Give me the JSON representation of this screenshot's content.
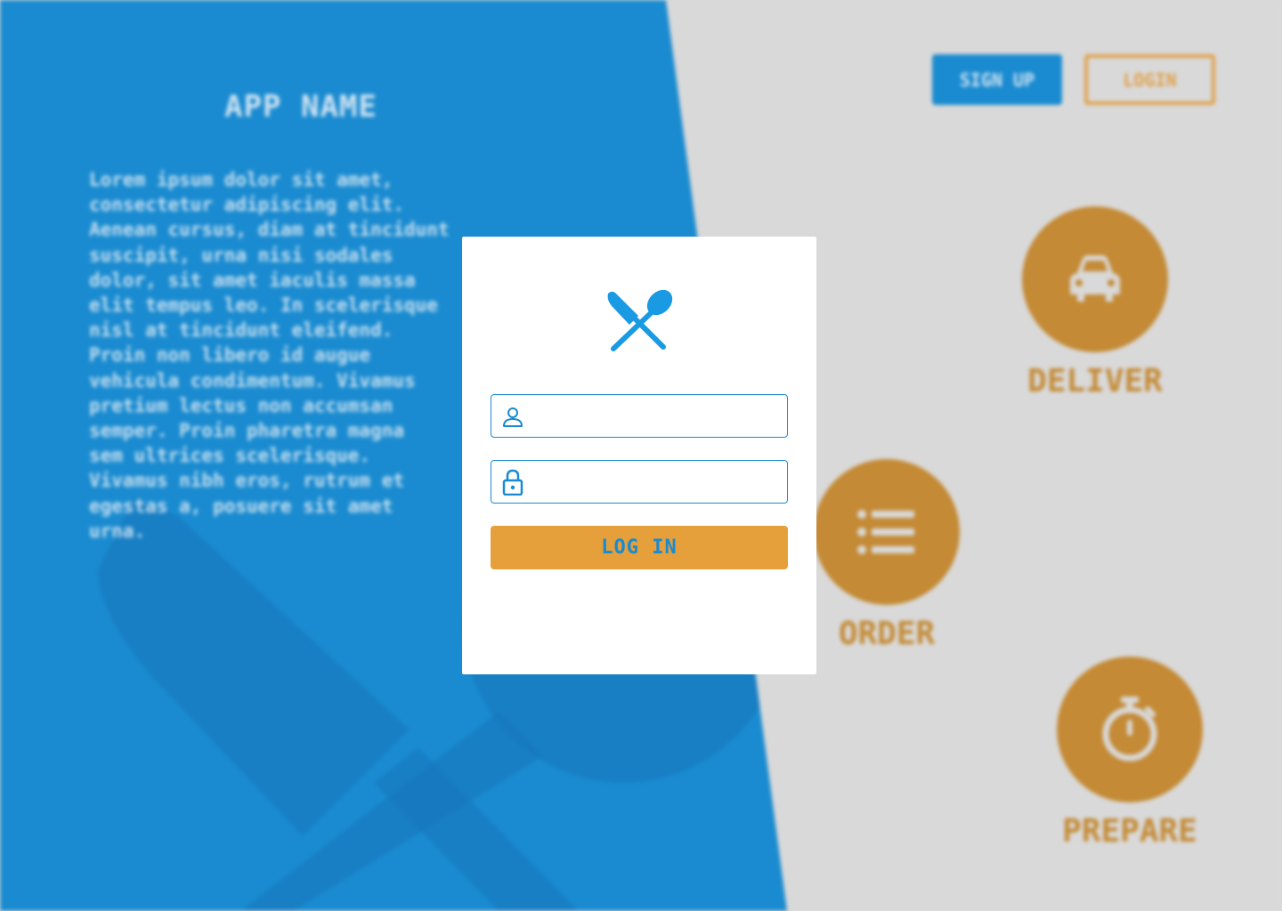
{
  "background": {
    "app_name": "APP NAME",
    "description": "Lorem ipsum dolor sit amet,\nconsectetur adipiscing elit.\nAenean cursus, diam at tincidunt\nsuscipit, urna nisi sodales\ndolor, sit amet iaculis massa\nelit tempus leo. In scelerisque\nnisl at tincidunt eleifend.\nProin non libero id augue\nvehicula condimentum. Vivamus\npretium lectus non accumsan\nsemper. Proin pharetra magna\nsem ultrices scelerisque.\nVivamus nibh eros, rutrum et\negestas a, posuere sit amet\nurna.",
    "nav": {
      "signup_label": "SIGN UP",
      "login_label": "LOGIN"
    },
    "features": [
      {
        "label": "DELIVER",
        "icon": "car-icon"
      },
      {
        "label": "ORDER",
        "icon": "list-icon"
      },
      {
        "label": "PREPARE",
        "icon": "stopwatch-icon"
      }
    ]
  },
  "modal": {
    "logo_icon": "knife-spoon-icon",
    "username": {
      "icon": "user-icon",
      "value": "",
      "placeholder": ""
    },
    "password": {
      "icon": "lock-icon",
      "value": "",
      "placeholder": ""
    },
    "submit_label": "LOG IN"
  },
  "colors": {
    "primary_blue": "#1a8bd0",
    "accent_orange": "#e59f3b",
    "feature_orange": "#c48a35",
    "background_gray": "#d9d9d9"
  }
}
